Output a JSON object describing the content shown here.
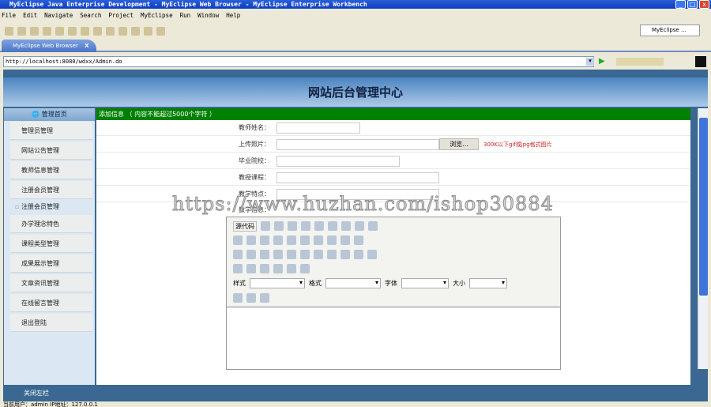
{
  "window": {
    "title": "MyEclipse Java Enterprise Development - MyEclipse Web Browser - MyEclipse Enterprise Workbench"
  },
  "menu": [
    "File",
    "Edit",
    "Navigate",
    "Search",
    "Project",
    "MyEclipse",
    "Run",
    "Window",
    "Help"
  ],
  "perspective": "MyEclipse ...",
  "tab": {
    "label": "MyEclipse Web Browser",
    "close": "X"
  },
  "browser": {
    "url": "http://localhost:8080/wdxx/Admin.do"
  },
  "page": {
    "title": "网站后台管理中心",
    "sidebar": {
      "head": "管理首页",
      "items": [
        "管理员管理",
        "网站公告管理",
        "教师信息管理",
        "注册会员管理",
        "注册会员管理",
        "办学理念特色",
        "课程类型管理",
        "成果展示管理",
        "文章资讯管理",
        "在线留言管理",
        "退出登陆"
      ]
    },
    "form": {
      "heading": "添加信息 （ 内容不能超过5000个字符 ）",
      "fields": [
        {
          "label": "教师姓名："
        },
        {
          "label": "上传照片："
        },
        {
          "label": "毕业院校："
        },
        {
          "label": "教授课程："
        },
        {
          "label": "教学特点："
        },
        {
          "label": "教学信息："
        }
      ],
      "browse": "浏览...",
      "hint": "300K以下gif或jpg格式图片"
    },
    "editor": {
      "source": "源代码",
      "style": "样式",
      "format": "格式",
      "font": "字体",
      "size": "大小"
    },
    "close_sidebar": "关闭左栏"
  },
  "status": "当前用户：admin  IP地址：127.0.0.1",
  "watermark": "https://www.huzhan.com/ishop30884"
}
